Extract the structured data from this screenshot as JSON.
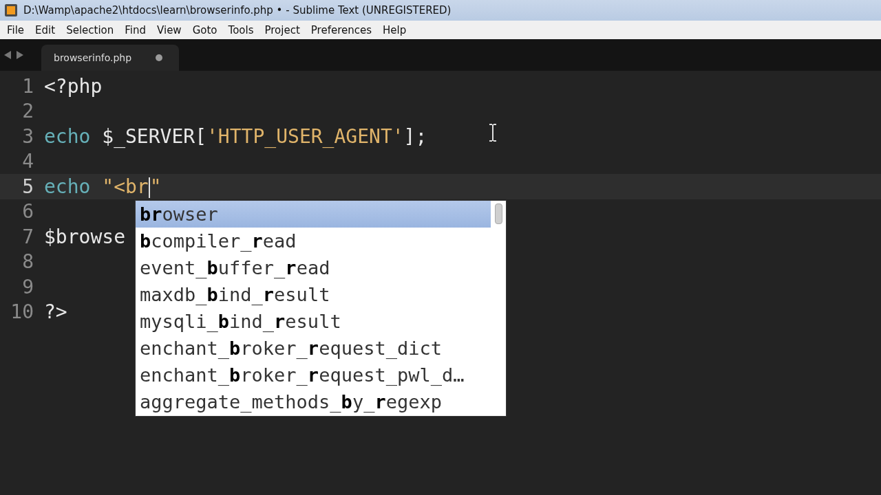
{
  "window": {
    "title": "D:\\Wamp\\apache2\\htdocs\\learn\\browserinfo.php • - Sublime Text (UNREGISTERED)"
  },
  "menu": [
    "File",
    "Edit",
    "Selection",
    "Find",
    "View",
    "Goto",
    "Tools",
    "Project",
    "Preferences",
    "Help"
  ],
  "tabs": [
    {
      "label": "browserinfo.php",
      "selected": true,
      "modified": true
    }
  ],
  "editor": {
    "lines": [
      {
        "number": "1",
        "current": false,
        "tokens": [
          {
            "kind": "plain",
            "text": "<?php"
          }
        ]
      },
      {
        "number": "2",
        "current": false
      },
      {
        "number": "3",
        "current": false,
        "tokens": [
          {
            "kind": "keyword",
            "text": "echo"
          },
          {
            "kind": "plain",
            "text": " $_SERVER["
          },
          {
            "kind": "string",
            "text": "'HTTP_USER_AGENT'"
          },
          {
            "kind": "plain",
            "text": "];"
          }
        ]
      },
      {
        "number": "4",
        "current": false
      },
      {
        "number": "5",
        "current": true,
        "tokens": [
          {
            "kind": "keyword",
            "text": "echo"
          },
          {
            "kind": "string",
            "text": " \"<br"
          },
          {
            "kind": "caret"
          },
          {
            "kind": "string",
            "text": "\""
          }
        ]
      },
      {
        "number": "6",
        "current": false
      },
      {
        "number": "7",
        "current": false,
        "tokens": [
          {
            "kind": "plain",
            "text": "$browse"
          }
        ]
      },
      {
        "number": "8",
        "current": false
      },
      {
        "number": "9",
        "current": false
      },
      {
        "number": "10",
        "current": false,
        "tokens": [
          {
            "kind": "plain",
            "text": "?>"
          }
        ]
      }
    ]
  },
  "completions": [
    {
      "text": "**br**owser",
      "selected": true
    },
    {
      "text": "**b**compiler_**r**ead",
      "selected": false
    },
    {
      "text": "event_**b**uffer_**r**ead",
      "selected": false
    },
    {
      "text": "maxdb_**b**ind_**r**esult",
      "selected": false
    },
    {
      "text": "mysqli_**b**ind_**r**esult",
      "selected": false
    },
    {
      "text": "enchant_**b**roker_**r**equest_dict",
      "selected": false
    },
    {
      "text": "enchant_**b**roker_**r**equest_pwl_d…",
      "selected": false
    },
    {
      "text": "aggregate_methods_**b**y_**r**egexp",
      "selected": false
    }
  ]
}
